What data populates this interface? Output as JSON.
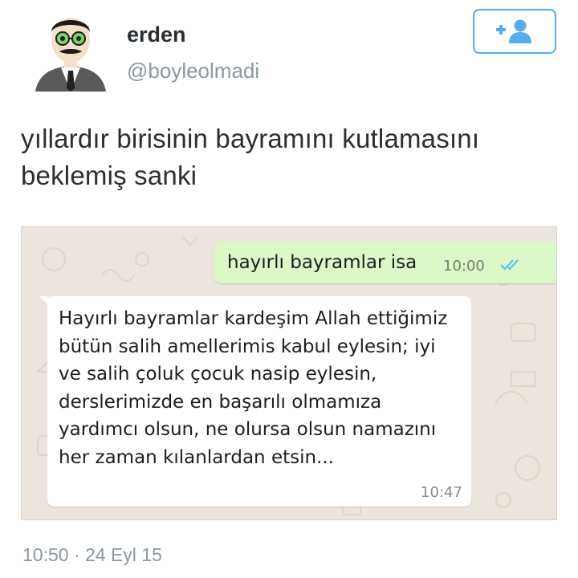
{
  "profile": {
    "name": "erden",
    "handle": "@boyleolmadi"
  },
  "tweet": {
    "text": "yıllardır birisinin bayramını kutlamasını beklemiş sanki",
    "timestamp": "10:50 · 24 Eyl 15"
  },
  "chat": {
    "outgoing": {
      "text": "hayırlı bayramlar isa",
      "time": "10:00"
    },
    "incoming": {
      "text": "Hayırlı bayramlar kardeşim Allah ettiğimiz bütün salih amellerimis kabul eylesin; iyi ve salih çoluk çocuk nasip eylesin, derslerimizde en başarılı olmamıza yardımcı olsun, ne olursa olsun namazını her zaman kılanlardan etsin...",
      "time": "10:47"
    }
  },
  "colors": {
    "accent": "#55acee",
    "outgoing_bubble": "#dcf8c6",
    "chat_background": "#ece5dd",
    "read_ticks": "#4fc3f7"
  },
  "icons": {
    "follow": "add-user-icon",
    "read_receipt": "double-check-icon"
  }
}
